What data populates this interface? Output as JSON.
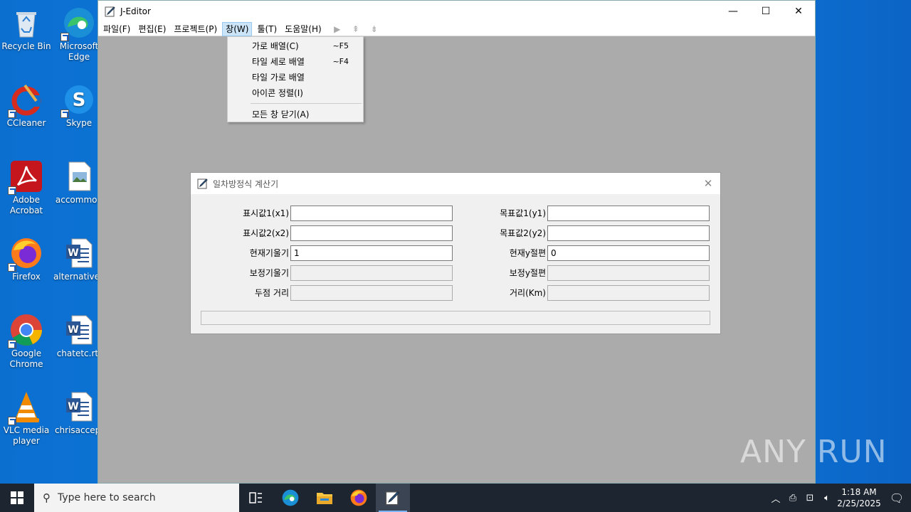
{
  "desktop": {
    "icons": [
      {
        "label": "Recycle Bin"
      },
      {
        "label": "Microsoft Edge"
      },
      {
        "label": "CCleaner"
      },
      {
        "label": "Skype"
      },
      {
        "label": "Adobe Acrobat"
      },
      {
        "label": "accommod"
      },
      {
        "label": "Firefox"
      },
      {
        "label": "alternativeu"
      },
      {
        "label": "Google Chrome"
      },
      {
        "label": "chatetc.rtf"
      },
      {
        "label": "VLC media player"
      },
      {
        "label": "chrisaccep."
      }
    ]
  },
  "window": {
    "title": "J-Editor",
    "menus": [
      "파일(F)",
      "편집(E)",
      "프로젝트(P)",
      "창(W)",
      "툴(T)",
      "도움말(H)"
    ],
    "active_menu": "창(W)",
    "controls": {
      "minimize": "—",
      "maximize": "☐",
      "close": "✕"
    }
  },
  "dropdown": {
    "items": [
      {
        "label": "가로 배열(C)",
        "shortcut": "~F5"
      },
      {
        "label": "타일 세로 배열",
        "shortcut": "~F4"
      },
      {
        "label": "타일 가로 배열",
        "shortcut": ""
      },
      {
        "label": "아이콘 정렬(I)",
        "shortcut": ""
      }
    ],
    "last_item": "모든 창 닫기(A)"
  },
  "dialog": {
    "title": "일차방정식 계산기",
    "close": "✕",
    "left_fields": [
      {
        "label": "표시값1(x1)",
        "value": "",
        "enabled": true
      },
      {
        "label": "표시값2(x2)",
        "value": "",
        "enabled": true
      },
      {
        "label": "현재기울기",
        "value": "1",
        "enabled": true
      },
      {
        "label": "보정기울기",
        "value": "",
        "enabled": false
      },
      {
        "label": "두점 거리",
        "value": "",
        "enabled": false
      }
    ],
    "right_fields": [
      {
        "label": "목표값1(y1)",
        "value": "",
        "enabled": true
      },
      {
        "label": "목표값2(y2)",
        "value": "",
        "enabled": true
      },
      {
        "label": "현재y절편",
        "value": "0",
        "enabled": true
      },
      {
        "label": "보정y절편",
        "value": "",
        "enabled": false
      },
      {
        "label": "거리(Km)",
        "value": "",
        "enabled": false
      }
    ]
  },
  "taskbar": {
    "search_placeholder": "Type here to search",
    "time": "1:18 AM",
    "date": "2/25/2025"
  },
  "watermark": "ANY RUN"
}
